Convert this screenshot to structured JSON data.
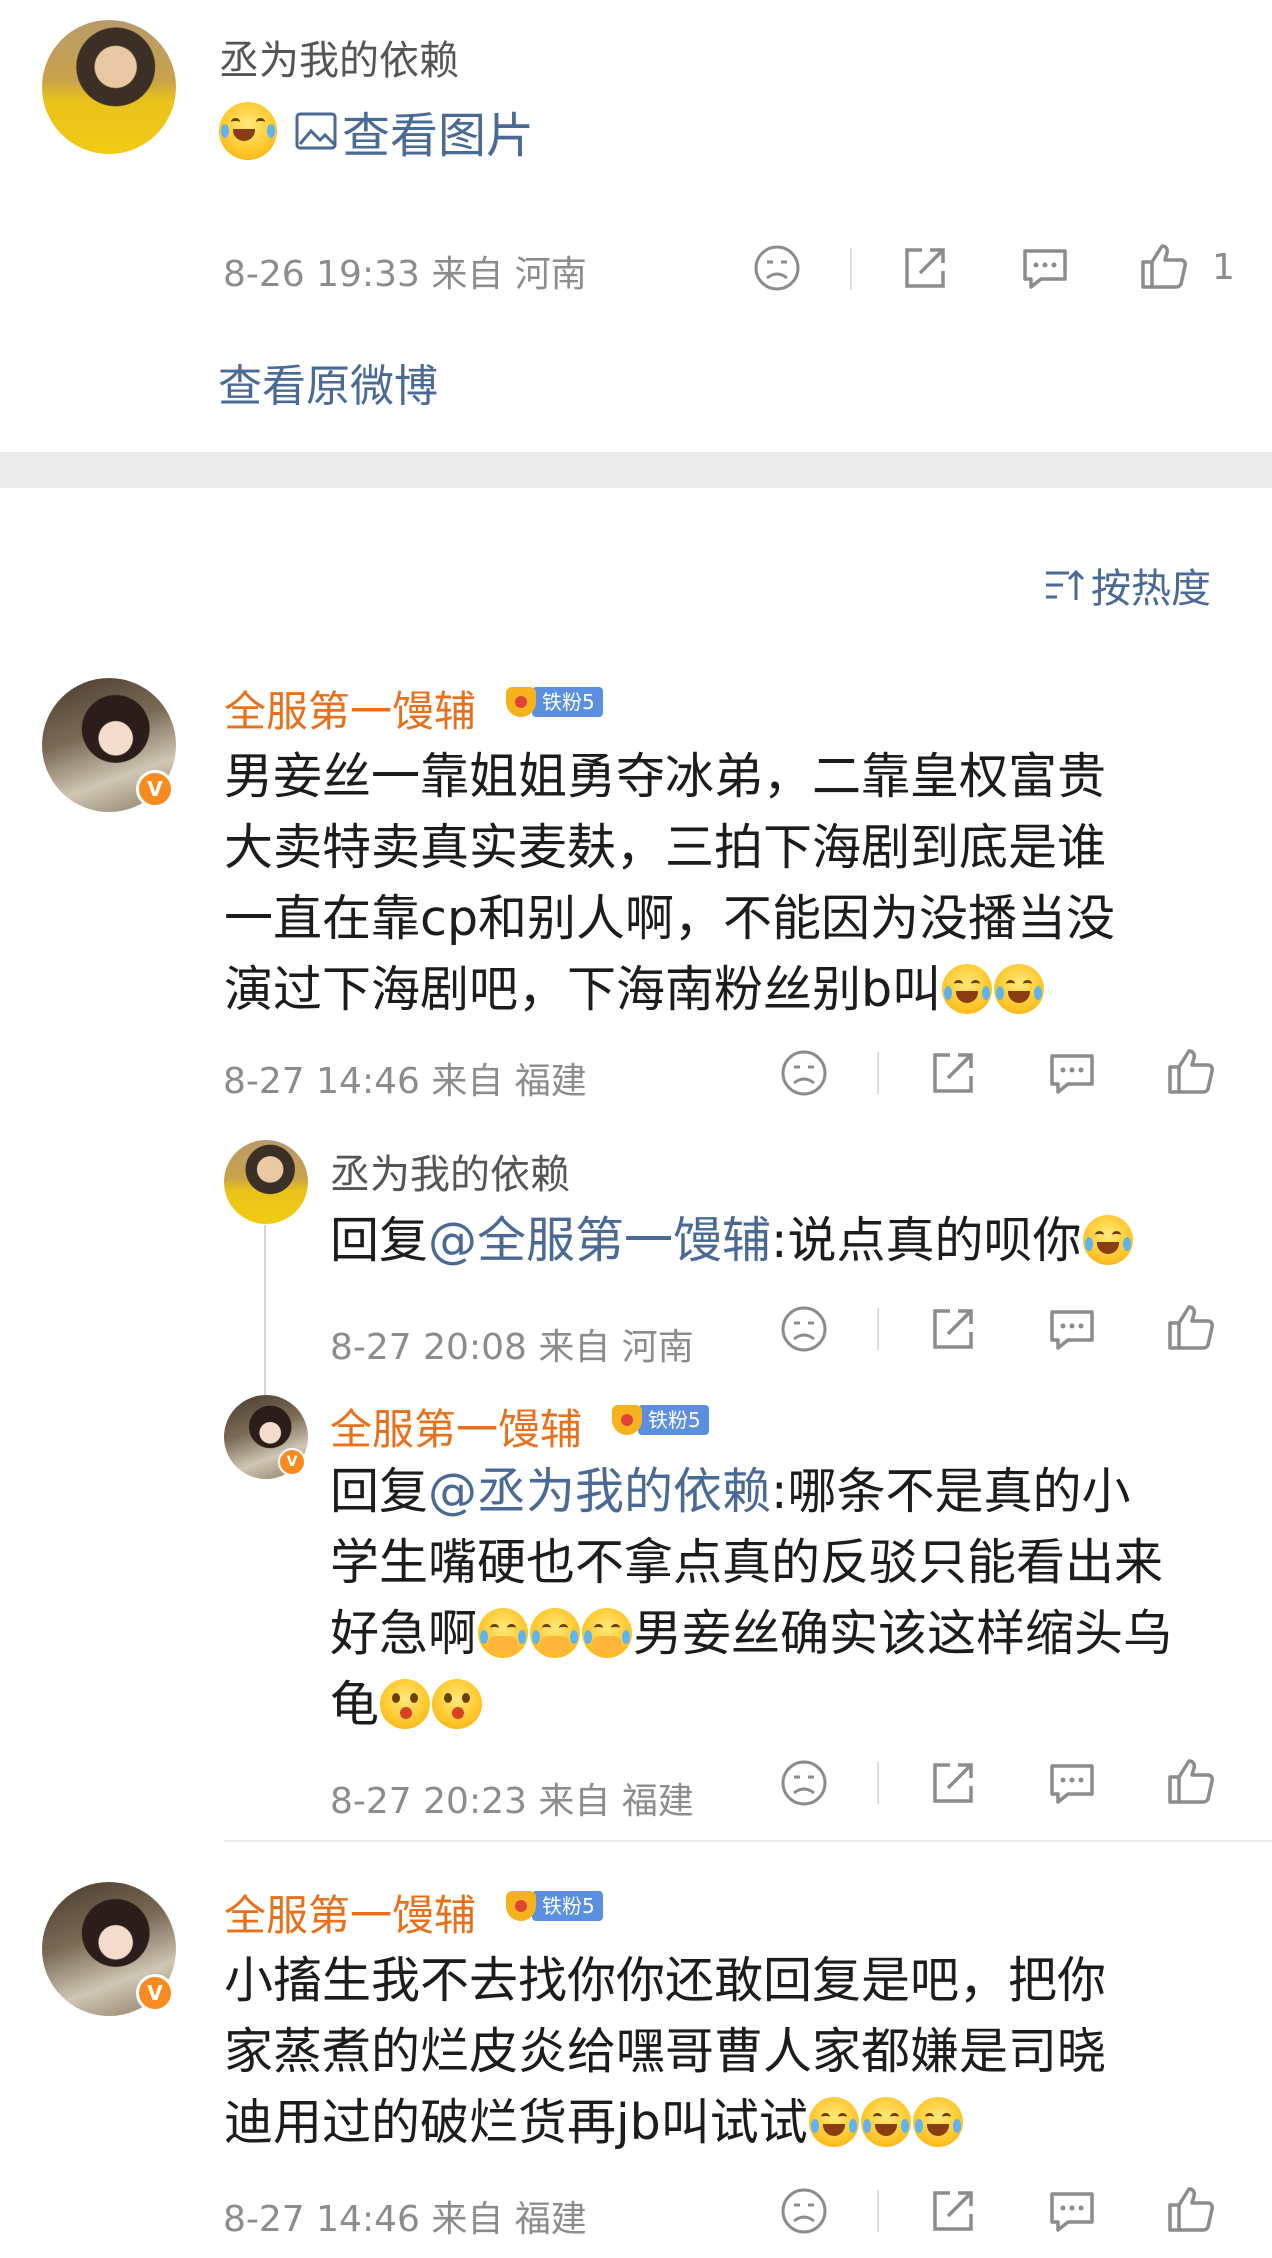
{
  "top_comment": {
    "author": "丞为我的依赖",
    "image_link": "查看图片",
    "meta": "8-26 19:33  来自 河南",
    "like_count": "1",
    "view_original": "查看原微博"
  },
  "sort": {
    "label": "按热度"
  },
  "comments": [
    {
      "author": "全服第一馒辅",
      "fan_badge": "铁粉5",
      "text": "男妾丝一靠姐姐勇夺冰弟，二靠皇权富贵大卖特卖真实麦麸，三拍下海剧到底是谁一直在靠cp和别人啊，不能因为没播当没演过下海剧吧，下海南粉丝别b叫",
      "meta": "8-27 14:46  来自 福建",
      "replies": [
        {
          "author": "丞为我的依赖",
          "reply_prefix": "回复",
          "mention": "@全服第一馒辅",
          "text": ":说点真的呗你",
          "meta": "8-27 20:08  来自 河南"
        },
        {
          "author": "全服第一馒辅",
          "fan_badge": "铁粉5",
          "reply_prefix": "回复",
          "mention": "@丞为我的依赖",
          "text_a": ":哪条不是真的小",
          "text_b": "学生嘴硬也不拿点真的反驳只能看出来",
          "text_c": "好急啊",
          "text_d": "男妾丝确实该这样缩头乌",
          "text_e": "龟",
          "meta": "8-27 20:23  来自 福建"
        }
      ]
    },
    {
      "author": "全服第一馒辅",
      "fan_badge": "铁粉5",
      "text": "小搐生我不去找你你还敢回复是吧，把你家蒸煮的烂皮炎给嘿哥曹人家都嫌是司晓迪用过的破烂货再jb叫试试",
      "meta": "8-27 14:46  来自 福建"
    }
  ],
  "comment1_lines": [
    "男妾丝一靠姐姐勇夺冰弟，二靠皇权富贵",
    "大卖特卖真实麦麸，三拍下海剧到底是谁",
    "一直在靠cp和别人啊，不能因为没播当没",
    "演过下海剧吧，下海南粉丝别b叫"
  ],
  "comment2_lines": [
    "小搐生我不去找你你还敢回复是吧，把你",
    "家蒸煮的烂皮炎给嘿哥曹人家都嫌是司晓",
    "迪用过的破烂货再jb叫试试"
  ],
  "colors": {
    "accent_orange": "#e8701b",
    "link_blue": "#4a6a95",
    "meta_gray": "#8c8c8c"
  }
}
